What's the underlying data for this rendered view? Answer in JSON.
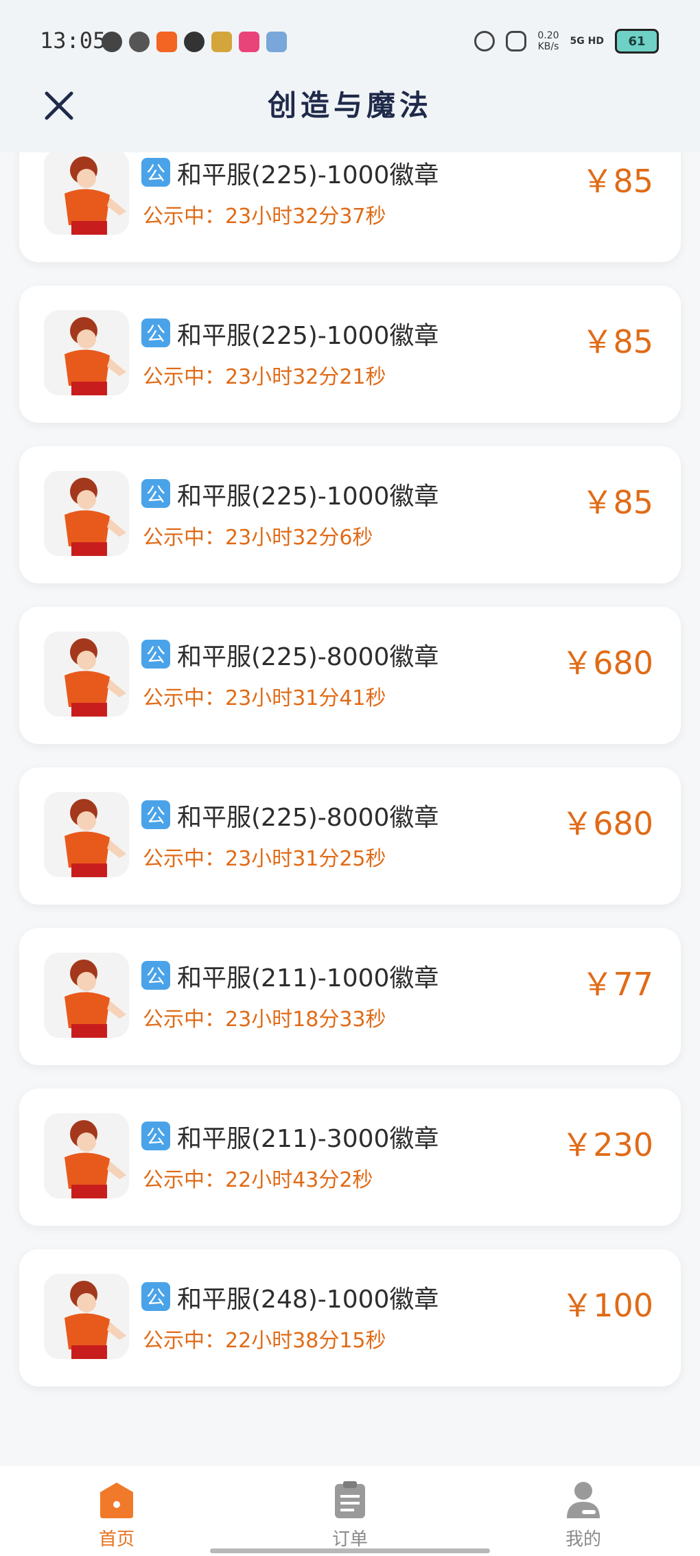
{
  "status_bar": {
    "time": "13:05",
    "net_rate": "0.20",
    "net_unit": "KB/s",
    "network": "5G HD",
    "battery": "61"
  },
  "header": {
    "title": "创造与魔法",
    "close_icon": "close-icon"
  },
  "colors": {
    "accent": "#e06b17",
    "badge_blue": "#4aa3e8",
    "nav_active": "#e8711c"
  },
  "listings": [
    {
      "badge": "公",
      "name": "和平服(225)-1000徽章",
      "countdown": "公示中：23小时32分37秒",
      "price": "￥85"
    },
    {
      "badge": "公",
      "name": "和平服(225)-1000徽章",
      "countdown": "公示中：23小时32分21秒",
      "price": "￥85"
    },
    {
      "badge": "公",
      "name": "和平服(225)-1000徽章",
      "countdown": "公示中：23小时32分6秒",
      "price": "￥85"
    },
    {
      "badge": "公",
      "name": "和平服(225)-8000徽章",
      "countdown": "公示中：23小时31分41秒",
      "price": "￥680"
    },
    {
      "badge": "公",
      "name": "和平服(225)-8000徽章",
      "countdown": "公示中：23小时31分25秒",
      "price": "￥680"
    },
    {
      "badge": "公",
      "name": "和平服(211)-1000徽章",
      "countdown": "公示中：23小时18分33秒",
      "price": "￥77"
    },
    {
      "badge": "公",
      "name": "和平服(211)-3000徽章",
      "countdown": "公示中：22小时43分2秒",
      "price": "￥230"
    },
    {
      "badge": "公",
      "name": "和平服(248)-1000徽章",
      "countdown": "公示中：22小时38分15秒",
      "price": "￥100"
    }
  ],
  "bottom_nav": [
    {
      "label": "首页",
      "icon": "home-icon",
      "active": true
    },
    {
      "label": "订单",
      "icon": "clipboard-icon",
      "active": false
    },
    {
      "label": "我的",
      "icon": "user-icon",
      "active": false
    }
  ]
}
